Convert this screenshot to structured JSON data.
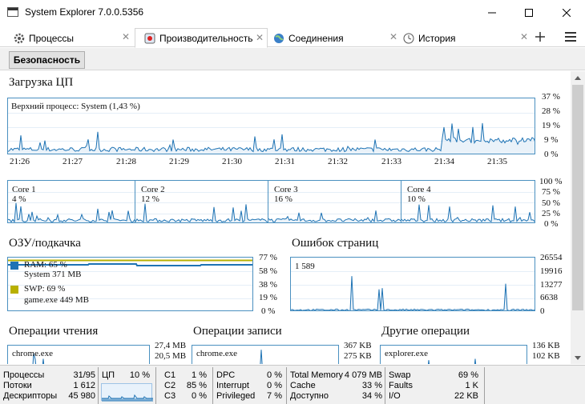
{
  "window": {
    "title": "System Explorer 7.0.0.5356"
  },
  "tabs": [
    {
      "label": "Процессы",
      "icon": "gear-process-icon",
      "active": false
    },
    {
      "label": "Производительность",
      "icon": "performance-icon",
      "active": true
    },
    {
      "label": "Соединения",
      "icon": "globe-icon",
      "active": false
    },
    {
      "label": "История",
      "icon": "clock-icon",
      "active": false
    }
  ],
  "toolbar": {
    "security_label": "Безопасность"
  },
  "cpu": {
    "title": "Загрузка ЦП",
    "top_process": "Верхний процесс: System (1,43 %)",
    "y_ticks": [
      "37 %",
      "28 %",
      "19 %",
      "9 %",
      "0 %"
    ],
    "x_ticks": [
      "21:26",
      "21:27",
      "21:28",
      "21:29",
      "21:30",
      "21:31",
      "21:32",
      "21:33",
      "21:34",
      "21:35"
    ],
    "core_ticks": [
      "100 %",
      "75 %",
      "50 %",
      "25 %",
      "0 %"
    ],
    "cores": [
      {
        "name": "Core 1",
        "value": "4 %"
      },
      {
        "name": "Core 2",
        "value": "12 %"
      },
      {
        "name": "Core 3",
        "value": "16 %"
      },
      {
        "name": "Core 4",
        "value": "10 %"
      }
    ]
  },
  "ram": {
    "title": "ОЗУ/подкачка",
    "ram_label": "RAM: 65 %",
    "ram_process": "System 371 MB",
    "swp_label": "SWP: 69 %",
    "swp_process": "game.exe 449 MB",
    "y_ticks": [
      "77 %",
      "58 %",
      "38 %",
      "19 %",
      "0 %"
    ],
    "ram_color": "#1e73b4",
    "swp_color": "#b8b000"
  },
  "faults": {
    "title": "Ошибок страниц",
    "value": "1 589",
    "y_ticks": [
      "26554",
      "19916",
      "13277",
      "6638",
      "0"
    ]
  },
  "io": {
    "read": {
      "title": "Операции чтения",
      "process": "chrome.exe",
      "ticks": [
        "27,4 MB",
        "20,5 MB"
      ]
    },
    "write": {
      "title": "Операции записи",
      "process": "chrome.exe",
      "ticks": [
        "367 KB",
        "275 KB"
      ]
    },
    "other": {
      "title": "Другие операции",
      "process": "explorer.exe",
      "ticks": [
        "136 KB",
        "102 KB"
      ]
    }
  },
  "status": {
    "processes_label": "Процессы",
    "processes_value": "31/95",
    "threads_label": "Потоки",
    "threads_value": "1 612",
    "handles_label": "Дескрипторы",
    "handles_value": "45 980",
    "cpu_label": "ЦП",
    "cpu_value": "10 %",
    "c1_label": "C1",
    "c1_value": "1 %",
    "c2_label": "C2",
    "c2_value": "85 %",
    "c3_label": "C3",
    "c3_value": "0 %",
    "dpc_label": "DPC",
    "dpc_value": "0 %",
    "interrupt_label": "Interrupt",
    "interrupt_value": "0 %",
    "privileged_label": "Privileged",
    "privileged_value": "7 %",
    "total_mem_label": "Total Memory",
    "total_mem_value": "4 079 MB",
    "cache_label": "Cache",
    "cache_value": "33 %",
    "available_label": "Доступно",
    "available_value": "34 %",
    "swap_label": "Swap",
    "swap_value": "69 %",
    "faults_label": "Faults",
    "faults_value": "1 K",
    "io_label": "I/O",
    "io_value": "22 KB"
  },
  "colors": {
    "graph_line": "#1e73b4",
    "graph_border": "#4a90c0",
    "ram_fill": "#1e73b4",
    "swap_line": "#b8b000"
  }
}
